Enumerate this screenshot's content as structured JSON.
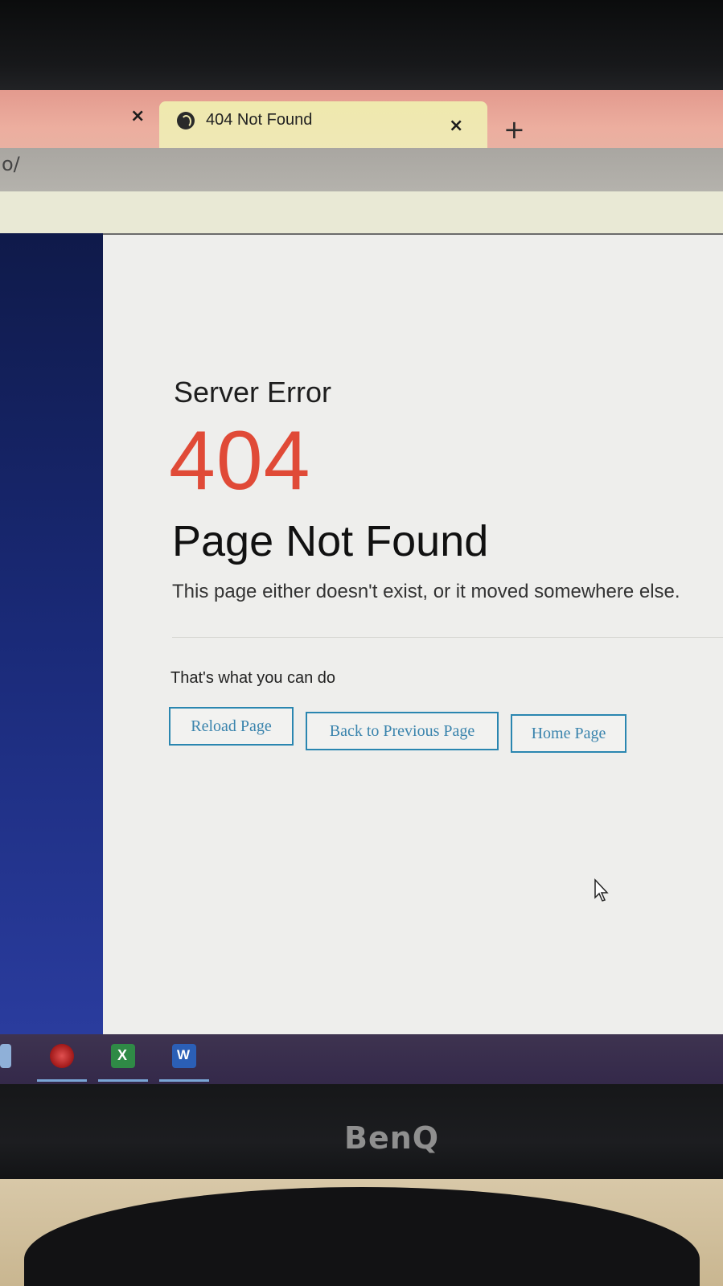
{
  "browser": {
    "tabs": [
      {
        "title": "",
        "close_label": "×"
      },
      {
        "title": "404 Not Found",
        "close_label": "×",
        "active": true
      }
    ],
    "new_tab_label": "+",
    "address_fragment": "o/"
  },
  "page": {
    "heading": "Server Error",
    "code": "404",
    "title": "Page Not Found",
    "description": "This page either doesn't exist, or it moved somewhere else.",
    "actions_label": "That's what you can do",
    "buttons": {
      "reload": "Reload Page",
      "back": "Back to Previous Page",
      "home": "Home Page"
    },
    "colors": {
      "code": "#e04a37",
      "button_border": "#2a86b0",
      "button_text": "#3a84ad"
    }
  },
  "taskbar": {
    "icons": [
      "edge-icon",
      "app-icon",
      "excel-icon",
      "word-icon"
    ]
  },
  "monitor": {
    "brand": "BenQ"
  }
}
